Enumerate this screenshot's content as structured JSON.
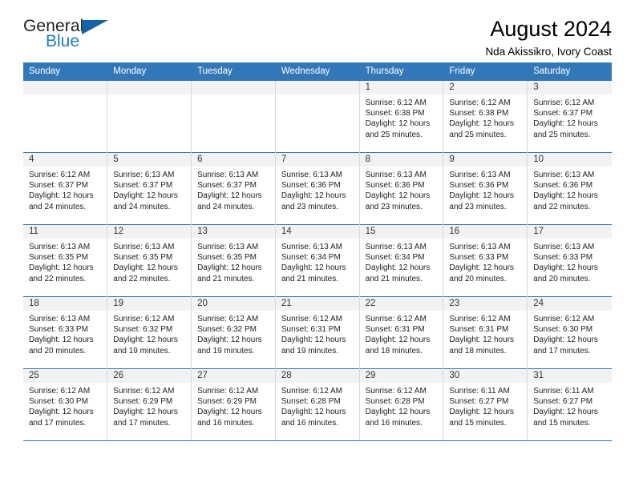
{
  "logo": {
    "word_top": "General",
    "word_bottom": "Blue",
    "accent_color": "#1463a8"
  },
  "header": {
    "title": "August 2024",
    "subtitle": "Nda Akissikro, Ivory Coast"
  },
  "theme": {
    "header_bg": "#3277b8",
    "daynum_bg": "#f2f2f2",
    "grid_line": "#3277b8"
  },
  "weekday_headers": [
    "Sunday",
    "Monday",
    "Tuesday",
    "Wednesday",
    "Thursday",
    "Friday",
    "Saturday"
  ],
  "weeks": [
    [
      {
        "day": "",
        "empty": true
      },
      {
        "day": "",
        "empty": true
      },
      {
        "day": "",
        "empty": true
      },
      {
        "day": "",
        "empty": true
      },
      {
        "day": "1",
        "sunrise": "Sunrise: 6:12 AM",
        "sunset": "Sunset: 6:38 PM",
        "daylight": "Daylight: 12 hours and 25 minutes."
      },
      {
        "day": "2",
        "sunrise": "Sunrise: 6:12 AM",
        "sunset": "Sunset: 6:38 PM",
        "daylight": "Daylight: 12 hours and 25 minutes."
      },
      {
        "day": "3",
        "sunrise": "Sunrise: 6:12 AM",
        "sunset": "Sunset: 6:37 PM",
        "daylight": "Daylight: 12 hours and 25 minutes."
      }
    ],
    [
      {
        "day": "4",
        "sunrise": "Sunrise: 6:12 AM",
        "sunset": "Sunset: 6:37 PM",
        "daylight": "Daylight: 12 hours and 24 minutes."
      },
      {
        "day": "5",
        "sunrise": "Sunrise: 6:13 AM",
        "sunset": "Sunset: 6:37 PM",
        "daylight": "Daylight: 12 hours and 24 minutes."
      },
      {
        "day": "6",
        "sunrise": "Sunrise: 6:13 AM",
        "sunset": "Sunset: 6:37 PM",
        "daylight": "Daylight: 12 hours and 24 minutes."
      },
      {
        "day": "7",
        "sunrise": "Sunrise: 6:13 AM",
        "sunset": "Sunset: 6:36 PM",
        "daylight": "Daylight: 12 hours and 23 minutes."
      },
      {
        "day": "8",
        "sunrise": "Sunrise: 6:13 AM",
        "sunset": "Sunset: 6:36 PM",
        "daylight": "Daylight: 12 hours and 23 minutes."
      },
      {
        "day": "9",
        "sunrise": "Sunrise: 6:13 AM",
        "sunset": "Sunset: 6:36 PM",
        "daylight": "Daylight: 12 hours and 23 minutes."
      },
      {
        "day": "10",
        "sunrise": "Sunrise: 6:13 AM",
        "sunset": "Sunset: 6:36 PM",
        "daylight": "Daylight: 12 hours and 22 minutes."
      }
    ],
    [
      {
        "day": "11",
        "sunrise": "Sunrise: 6:13 AM",
        "sunset": "Sunset: 6:35 PM",
        "daylight": "Daylight: 12 hours and 22 minutes."
      },
      {
        "day": "12",
        "sunrise": "Sunrise: 6:13 AM",
        "sunset": "Sunset: 6:35 PM",
        "daylight": "Daylight: 12 hours and 22 minutes."
      },
      {
        "day": "13",
        "sunrise": "Sunrise: 6:13 AM",
        "sunset": "Sunset: 6:35 PM",
        "daylight": "Daylight: 12 hours and 21 minutes."
      },
      {
        "day": "14",
        "sunrise": "Sunrise: 6:13 AM",
        "sunset": "Sunset: 6:34 PM",
        "daylight": "Daylight: 12 hours and 21 minutes."
      },
      {
        "day": "15",
        "sunrise": "Sunrise: 6:13 AM",
        "sunset": "Sunset: 6:34 PM",
        "daylight": "Daylight: 12 hours and 21 minutes."
      },
      {
        "day": "16",
        "sunrise": "Sunrise: 6:13 AM",
        "sunset": "Sunset: 6:33 PM",
        "daylight": "Daylight: 12 hours and 20 minutes."
      },
      {
        "day": "17",
        "sunrise": "Sunrise: 6:13 AM",
        "sunset": "Sunset: 6:33 PM",
        "daylight": "Daylight: 12 hours and 20 minutes."
      }
    ],
    [
      {
        "day": "18",
        "sunrise": "Sunrise: 6:13 AM",
        "sunset": "Sunset: 6:33 PM",
        "daylight": "Daylight: 12 hours and 20 minutes."
      },
      {
        "day": "19",
        "sunrise": "Sunrise: 6:12 AM",
        "sunset": "Sunset: 6:32 PM",
        "daylight": "Daylight: 12 hours and 19 minutes."
      },
      {
        "day": "20",
        "sunrise": "Sunrise: 6:12 AM",
        "sunset": "Sunset: 6:32 PM",
        "daylight": "Daylight: 12 hours and 19 minutes."
      },
      {
        "day": "21",
        "sunrise": "Sunrise: 6:12 AM",
        "sunset": "Sunset: 6:31 PM",
        "daylight": "Daylight: 12 hours and 19 minutes."
      },
      {
        "day": "22",
        "sunrise": "Sunrise: 6:12 AM",
        "sunset": "Sunset: 6:31 PM",
        "daylight": "Daylight: 12 hours and 18 minutes."
      },
      {
        "day": "23",
        "sunrise": "Sunrise: 6:12 AM",
        "sunset": "Sunset: 6:31 PM",
        "daylight": "Daylight: 12 hours and 18 minutes."
      },
      {
        "day": "24",
        "sunrise": "Sunrise: 6:12 AM",
        "sunset": "Sunset: 6:30 PM",
        "daylight": "Daylight: 12 hours and 17 minutes."
      }
    ],
    [
      {
        "day": "25",
        "sunrise": "Sunrise: 6:12 AM",
        "sunset": "Sunset: 6:30 PM",
        "daylight": "Daylight: 12 hours and 17 minutes."
      },
      {
        "day": "26",
        "sunrise": "Sunrise: 6:12 AM",
        "sunset": "Sunset: 6:29 PM",
        "daylight": "Daylight: 12 hours and 17 minutes."
      },
      {
        "day": "27",
        "sunrise": "Sunrise: 6:12 AM",
        "sunset": "Sunset: 6:29 PM",
        "daylight": "Daylight: 12 hours and 16 minutes."
      },
      {
        "day": "28",
        "sunrise": "Sunrise: 6:12 AM",
        "sunset": "Sunset: 6:28 PM",
        "daylight": "Daylight: 12 hours and 16 minutes."
      },
      {
        "day": "29",
        "sunrise": "Sunrise: 6:12 AM",
        "sunset": "Sunset: 6:28 PM",
        "daylight": "Daylight: 12 hours and 16 minutes."
      },
      {
        "day": "30",
        "sunrise": "Sunrise: 6:11 AM",
        "sunset": "Sunset: 6:27 PM",
        "daylight": "Daylight: 12 hours and 15 minutes."
      },
      {
        "day": "31",
        "sunrise": "Sunrise: 6:11 AM",
        "sunset": "Sunset: 6:27 PM",
        "daylight": "Daylight: 12 hours and 15 minutes."
      }
    ]
  ]
}
